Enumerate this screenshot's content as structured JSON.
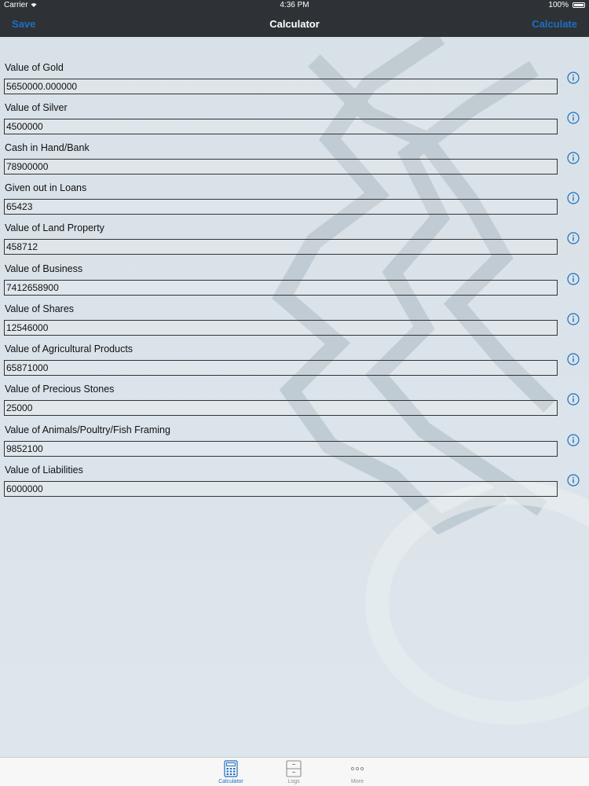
{
  "status_bar": {
    "carrier": "Carrier",
    "time": "4:36 PM",
    "battery": "100%"
  },
  "nav": {
    "left_button": "Save",
    "title": "Calculator",
    "right_button": "Calculate"
  },
  "fields": [
    {
      "label": "Value of Gold",
      "value": "5650000.000000"
    },
    {
      "label": "Value of Silver",
      "value": "4500000"
    },
    {
      "label": "Cash in Hand/Bank",
      "value": "78900000"
    },
    {
      "label": "Given out in Loans",
      "value": "65423"
    },
    {
      "label": "Value of Land Property",
      "value": "458712"
    },
    {
      "label": "Value of Business",
      "value": "7412658900"
    },
    {
      "label": "Value of Shares",
      "value": "12546000"
    },
    {
      "label": "Value of Agricultural Products",
      "value": "65871000"
    },
    {
      "label": "Value of Precious Stones",
      "value": "25000"
    },
    {
      "label": "Value of Animals/Poultry/Fish Framing",
      "value": "9852100"
    },
    {
      "label": "Value of Liabilities",
      "value": "6000000"
    }
  ],
  "tabs": [
    {
      "label": "Calculator",
      "icon": "calculator-icon",
      "active": true
    },
    {
      "label": "Logs",
      "icon": "logs-icon",
      "active": false
    },
    {
      "label": "More",
      "icon": "more-icon",
      "active": false
    }
  ],
  "colors": {
    "accent": "#1d6fc1",
    "bar": "#2e3236"
  }
}
